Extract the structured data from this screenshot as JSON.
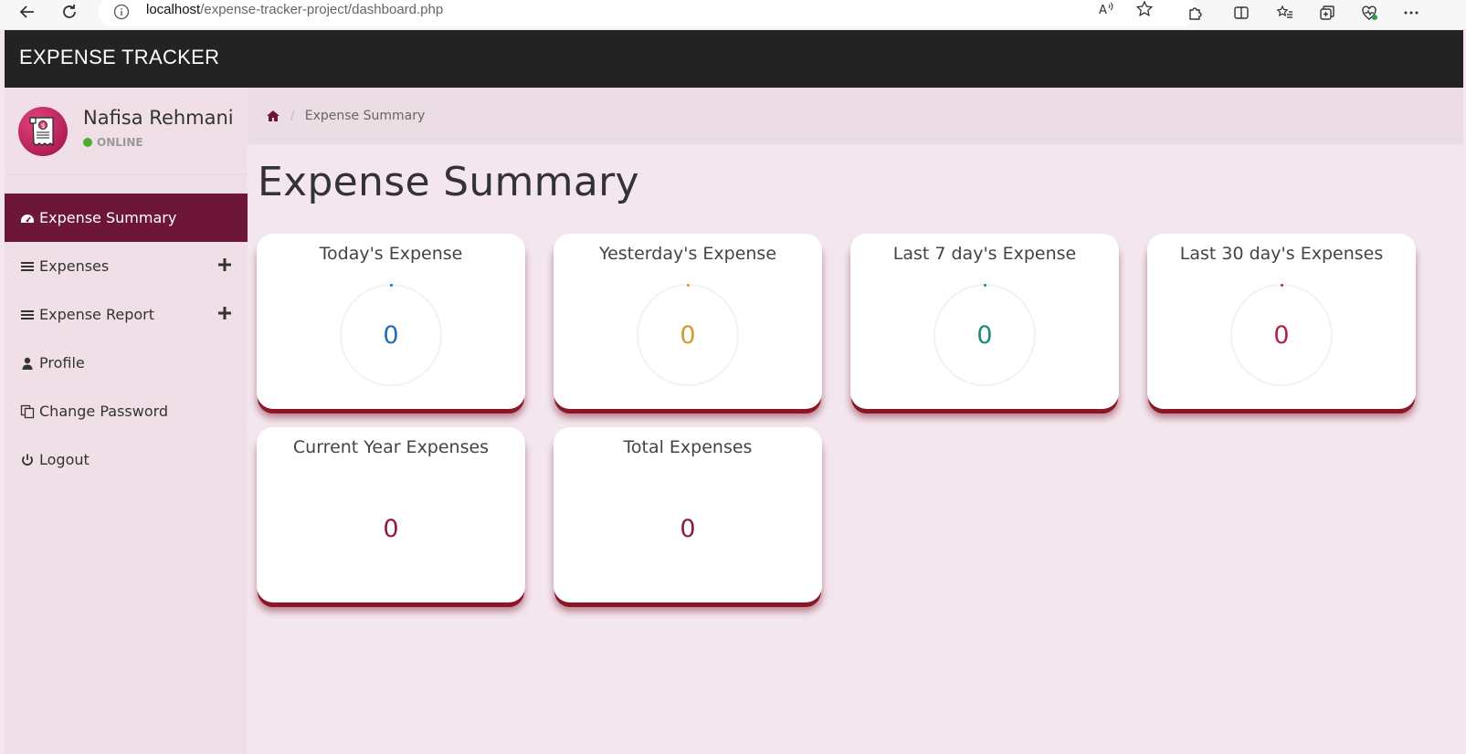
{
  "browser": {
    "url_host": "localhost",
    "url_path": "/expense-tracker-project/dashboard.php"
  },
  "app": {
    "title": "EXPENSE TRACKER"
  },
  "user": {
    "name": "Nafisa Rehmani",
    "status": "ONLINE"
  },
  "sidebar": {
    "items": [
      {
        "label": "Expense Summary",
        "icon": "dashboard-icon",
        "active": true
      },
      {
        "label": "Expenses",
        "icon": "bars-icon",
        "expandable": true
      },
      {
        "label": "Expense Report",
        "icon": "bars-icon",
        "expandable": true
      },
      {
        "label": "Profile",
        "icon": "user-icon"
      },
      {
        "label": "Change Password",
        "icon": "copy-icon"
      },
      {
        "label": "Logout",
        "icon": "power-icon"
      }
    ]
  },
  "breadcrumb": {
    "current": "Expense Summary"
  },
  "page": {
    "title": "Expense Summary"
  },
  "cards": [
    {
      "title": "Today's Expense",
      "value": "0",
      "color": "#1f6fb2"
    },
    {
      "title": "Yesterday's Expense",
      "value": "0",
      "color": "#d59a2c"
    },
    {
      "title": "Last 7 day's Expense",
      "value": "0",
      "color": "#1e8a7a"
    },
    {
      "title": "Last 30 day's Expenses",
      "value": "0",
      "color": "#b0244a"
    },
    {
      "title": "Current Year Expenses",
      "value": "0",
      "color": "#8e1d3c"
    },
    {
      "title": "Total Expenses",
      "value": "0",
      "color": "#8e1d3c"
    }
  ],
  "colors": {
    "header": "#232323",
    "sidebar_active": "#6e1638",
    "card_shadow": "#8a1626"
  }
}
